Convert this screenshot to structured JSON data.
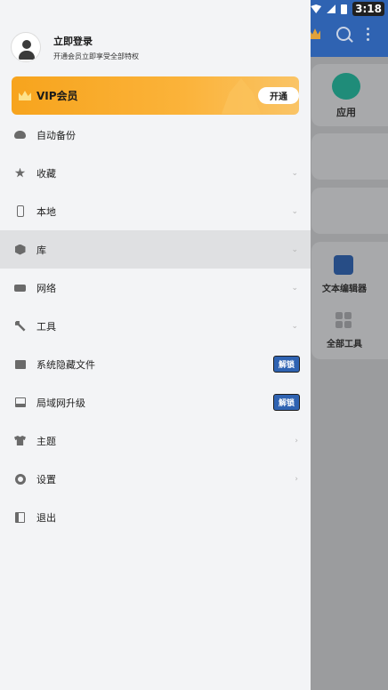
{
  "status_bar": {
    "time": "3:18"
  },
  "background": {
    "apps_label": "应用",
    "text_editor_label": "文本编辑器",
    "all_tools_label": "全部工具"
  },
  "profile": {
    "title": "立即登录",
    "subtitle": "开通会员立即享受全部特权"
  },
  "vip": {
    "label": "VIP会员",
    "button": "开通"
  },
  "menu": {
    "items": [
      {
        "label": "自动备份",
        "icon": "cloud-icon"
      },
      {
        "label": "收藏",
        "icon": "star-icon",
        "chevron": "⌄"
      },
      {
        "label": "本地",
        "icon": "phone-icon",
        "chevron": "⌄"
      },
      {
        "label": "库",
        "icon": "stack-icon",
        "chevron": "⌄",
        "active": true
      },
      {
        "label": "网络",
        "icon": "network-icon",
        "chevron": "⌄"
      },
      {
        "label": "工具",
        "icon": "wrench-icon",
        "chevron": "⌄"
      },
      {
        "label": "系统隐藏文件",
        "icon": "hidden-file-icon",
        "badge": "解锁"
      },
      {
        "label": "局域网升级",
        "icon": "monitor-icon",
        "badge": "解锁"
      },
      {
        "label": "主题",
        "icon": "shirt-icon",
        "chevron": "›"
      },
      {
        "label": "设置",
        "icon": "gear-icon",
        "chevron": "›"
      },
      {
        "label": "退出",
        "icon": "exit-icon"
      }
    ]
  },
  "colors": {
    "drawer_bg": "#f3f4f6",
    "vip_orange": "#f7a41d",
    "unlock_blue": "#2f63b2",
    "topbar_blue": "#2f63b2"
  }
}
